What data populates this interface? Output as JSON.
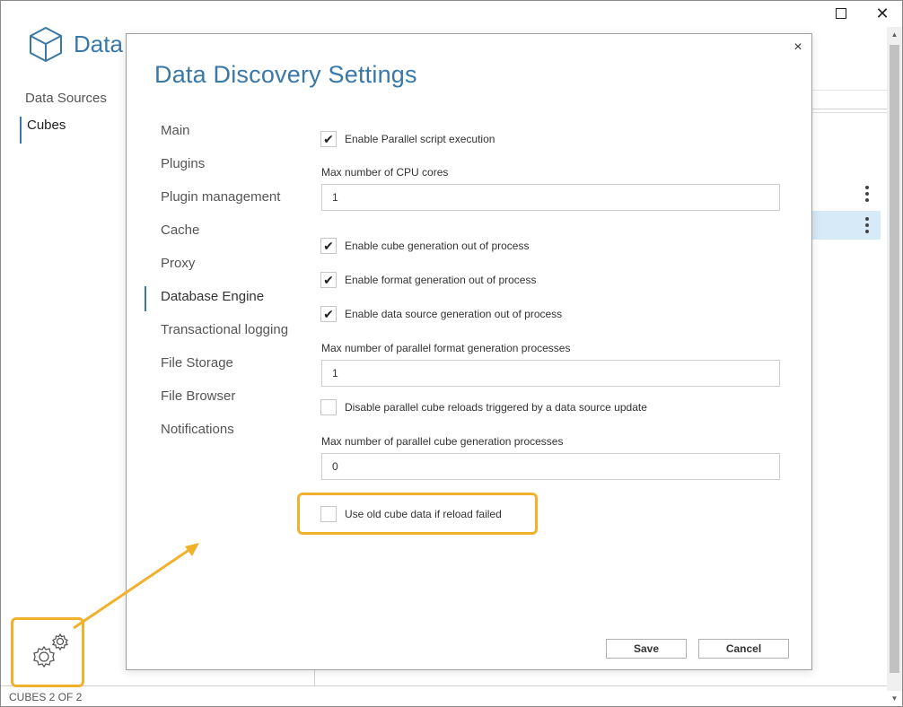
{
  "app": {
    "name": "Data",
    "nav": [
      {
        "label": "Data Sources",
        "active": false
      },
      {
        "label": "Cubes",
        "active": true
      }
    ]
  },
  "status_bar": {
    "text": "CUBES 2 OF 2"
  },
  "dialog": {
    "title": "Data Discovery Settings",
    "close_glyph": "×",
    "nav": [
      {
        "label": "Main",
        "active": false
      },
      {
        "label": "Plugins",
        "active": false
      },
      {
        "label": "Plugin management",
        "active": false
      },
      {
        "label": "Cache",
        "active": false
      },
      {
        "label": "Proxy",
        "active": false
      },
      {
        "label": "Database Engine",
        "active": true
      },
      {
        "label": "Transactional logging",
        "active": false
      },
      {
        "label": "File Storage",
        "active": false
      },
      {
        "label": "File Browser",
        "active": false
      },
      {
        "label": "Notifications",
        "active": false
      }
    ],
    "fields": {
      "parallel_script": {
        "label": "Enable Parallel script execution",
        "checked": true
      },
      "max_cpu_label": "Max number of CPU cores",
      "max_cpu_value": "1",
      "cube_out_of_process": {
        "label": "Enable cube generation out of process",
        "checked": true
      },
      "format_out_of_process": {
        "label": "Enable format generation out of process",
        "checked": true
      },
      "datasource_out_of_process": {
        "label": "Enable data source generation out of process",
        "checked": true
      },
      "max_format_label": "Max number of parallel format generation processes",
      "max_format_value": "1",
      "disable_parallel_reloads": {
        "label": "Disable parallel cube reloads triggered by a data source update",
        "checked": false
      },
      "max_cube_label": "Max number of parallel cube generation processes",
      "max_cube_value": "0",
      "use_old_cube_data": {
        "label": "Use old cube data if reload failed",
        "checked": false
      }
    },
    "buttons": {
      "save": "Save",
      "cancel": "Cancel"
    }
  },
  "icons": {
    "logo": "cube-icon",
    "settings": "gears-icon",
    "row_menu": "kebab-icon"
  },
  "colors": {
    "accent": "#3a78a8",
    "highlight": "#f0b22d",
    "selected_row": "#d6eaf8"
  }
}
